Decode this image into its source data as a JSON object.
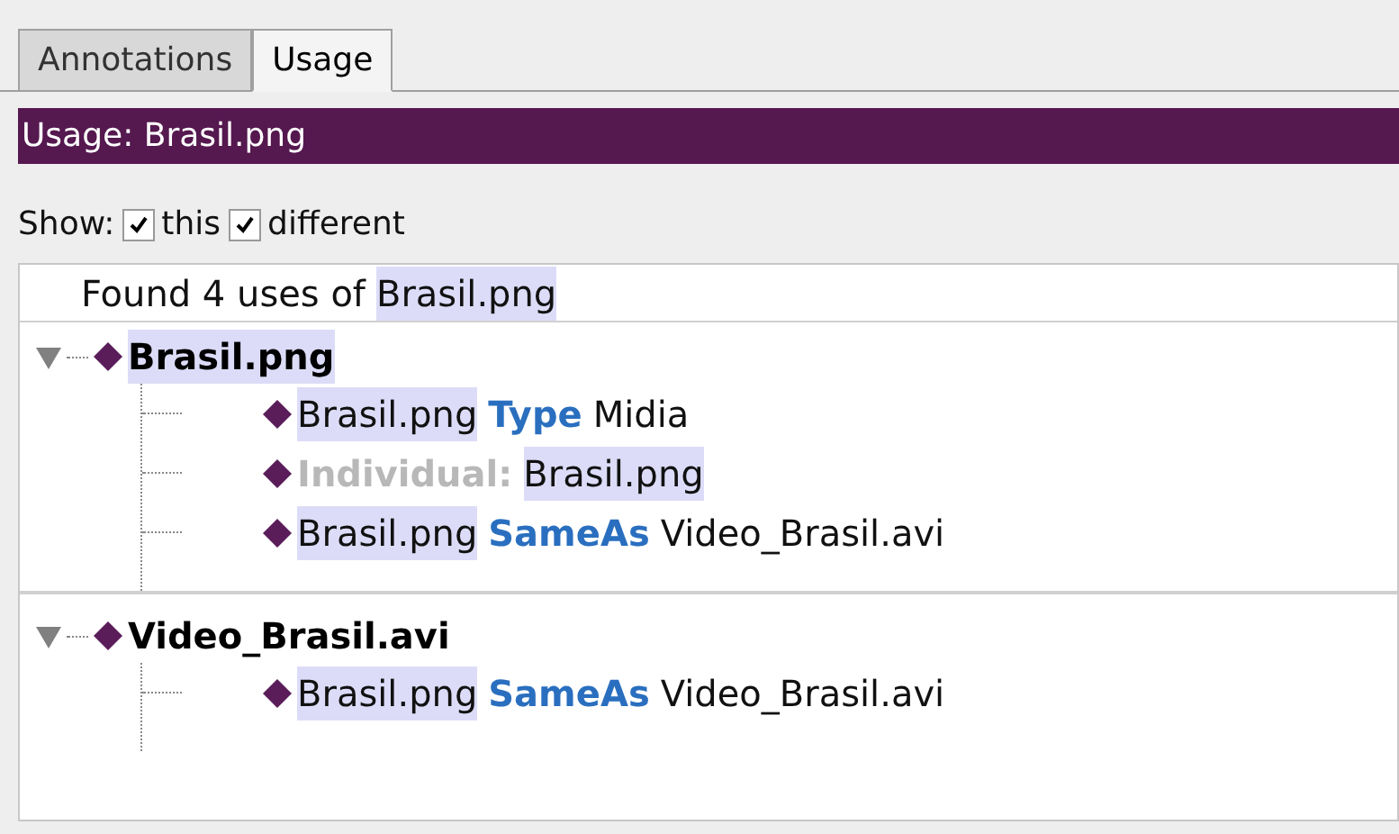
{
  "tabs": [
    {
      "label": "Annotations",
      "selected": false
    },
    {
      "label": "Usage",
      "selected": true
    }
  ],
  "title_bar": "Usage: Brasil.png",
  "show": {
    "label": "Show:",
    "options": [
      {
        "label": "this",
        "checked": true
      },
      {
        "label": "different",
        "checked": true
      }
    ]
  },
  "found": {
    "text": "Found 4 uses of",
    "entity": "Brasil.png"
  },
  "groups": [
    {
      "title": "Brasil.png",
      "highlighted": true,
      "expanded": true,
      "children": [
        {
          "parts": [
            {
              "text": "Brasil.png",
              "kind": "entity"
            },
            {
              "text": "Type",
              "kind": "keyword"
            },
            {
              "text": "Midia",
              "kind": "plain"
            }
          ]
        },
        {
          "parts": [
            {
              "text": "Individual:",
              "kind": "label"
            },
            {
              "text": "Brasil.png",
              "kind": "entity"
            }
          ]
        },
        {
          "parts": [
            {
              "text": "Brasil.png",
              "kind": "entity"
            },
            {
              "text": "SameAs",
              "kind": "keyword"
            },
            {
              "text": "Video_Brasil.avi",
              "kind": "plain"
            }
          ]
        }
      ]
    },
    {
      "title": "Video_Brasil.avi",
      "highlighted": false,
      "expanded": true,
      "children": [
        {
          "parts": [
            {
              "text": "Brasil.png",
              "kind": "entity"
            },
            {
              "text": "SameAs",
              "kind": "keyword"
            },
            {
              "text": "Video_Brasil.avi",
              "kind": "plain"
            }
          ]
        }
      ]
    }
  ]
}
